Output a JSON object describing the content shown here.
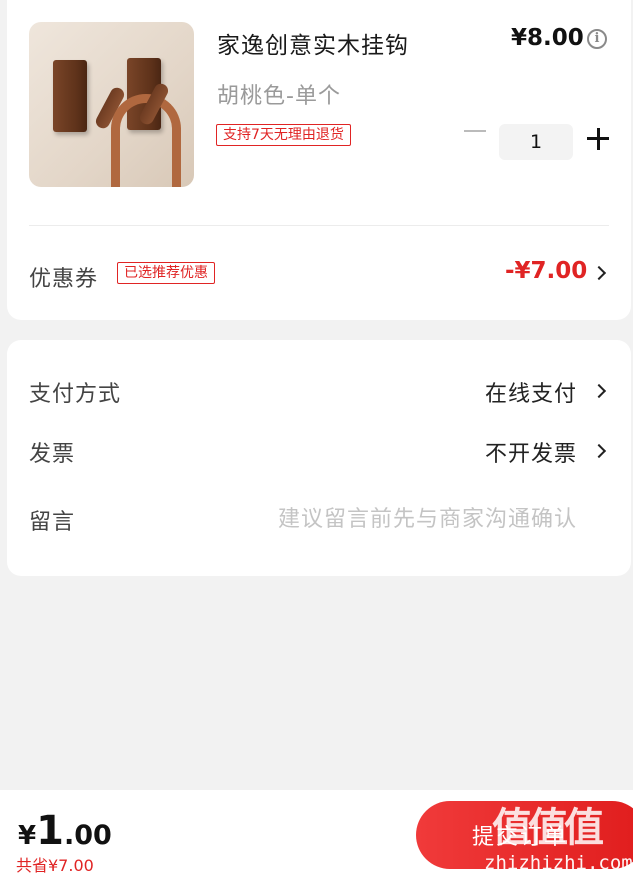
{
  "product": {
    "title": "家逸创意实木挂钩",
    "price": "¥8.00",
    "info_icon": "info-icon",
    "variant": "胡桃色-单个",
    "return_tag": "支持7天无理由退货",
    "quantity": "1"
  },
  "coupon": {
    "label": "优惠券",
    "tag": "已选推荐优惠",
    "value": "-¥7.00"
  },
  "options": {
    "payment_label": "支付方式",
    "payment_value": "在线支付",
    "invoice_label": "发票",
    "invoice_value": "不开发票",
    "message_label": "留言",
    "message_placeholder": "建议留言前先与商家沟通确认"
  },
  "footer": {
    "currency": "¥",
    "total_int": "1",
    "total_dec": ".00",
    "saved": "共省¥7.00",
    "submit_label": "提交订单"
  },
  "watermark": {
    "logo": "值值值",
    "text": "zhizhizhi.com"
  },
  "colors": {
    "accent": "#e02424",
    "background": "#f2f2f2"
  }
}
